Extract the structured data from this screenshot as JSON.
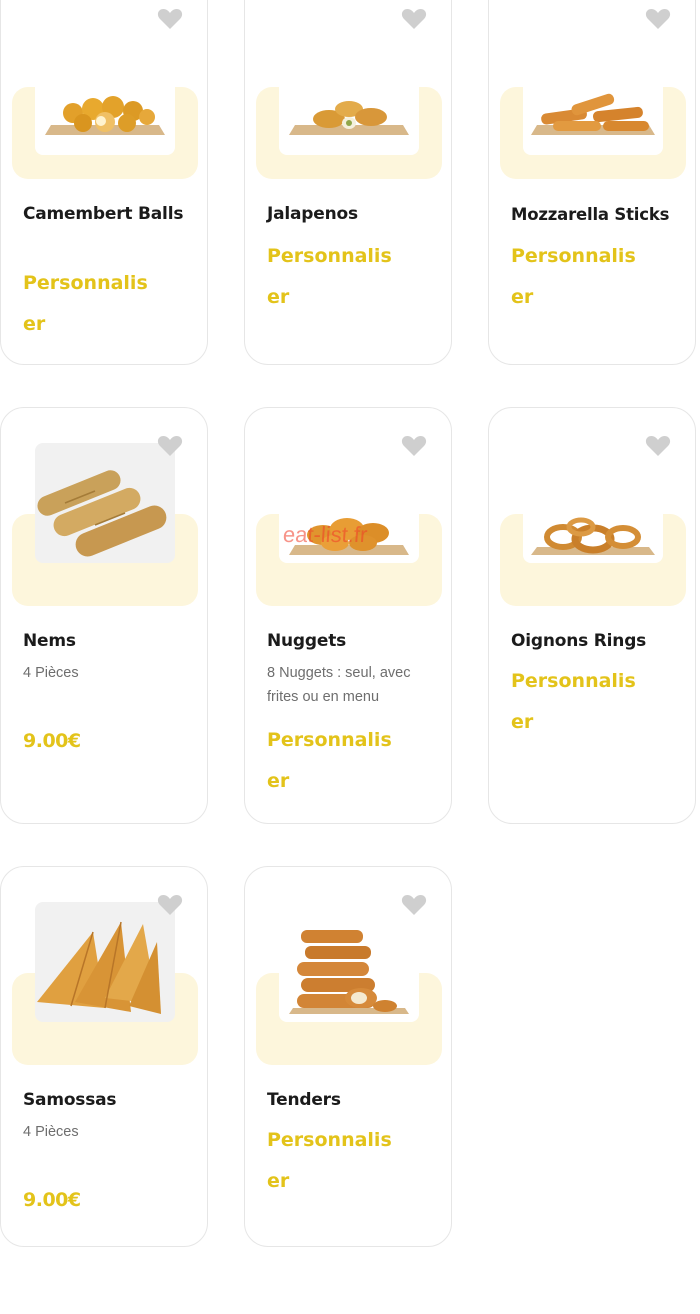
{
  "colors": {
    "accent": "#e3c31a",
    "card_halo": "#fdf6dc",
    "heart": "#cfcfcf",
    "title": "#1b1b1b",
    "description": "#6e6e6e"
  },
  "products": [
    {
      "name": "Camembert Balls",
      "cta": "Personnaliser",
      "image": "camembert-balls-photo"
    },
    {
      "name": "Jalapenos",
      "cta": "Personnaliser",
      "image": "jalapenos-photo"
    },
    {
      "name": "Mozzarella Sticks",
      "cta": "Personnaliser",
      "image": "mozzarella-sticks-photo"
    },
    {
      "name": "Nems",
      "description": "4 Pièces",
      "price": "9.00€",
      "image": "nems-photo"
    },
    {
      "name": "Nuggets",
      "description": "8 Nuggets : seul, avec frites ou en menu",
      "cta": "Personnaliser",
      "image": "nuggets-photo",
      "watermark": "eat-list.fr"
    },
    {
      "name": "Oignons Rings",
      "cta": "Personnaliser",
      "image": "onion-rings-photo"
    },
    {
      "name": "Samossas",
      "description": "4 Pièces",
      "price": "9.00€",
      "image": "samossas-photo"
    },
    {
      "name": "Tenders",
      "cta": "Personnaliser",
      "image": "tenders-photo"
    }
  ],
  "icons": {
    "favorite": "heart-icon"
  }
}
